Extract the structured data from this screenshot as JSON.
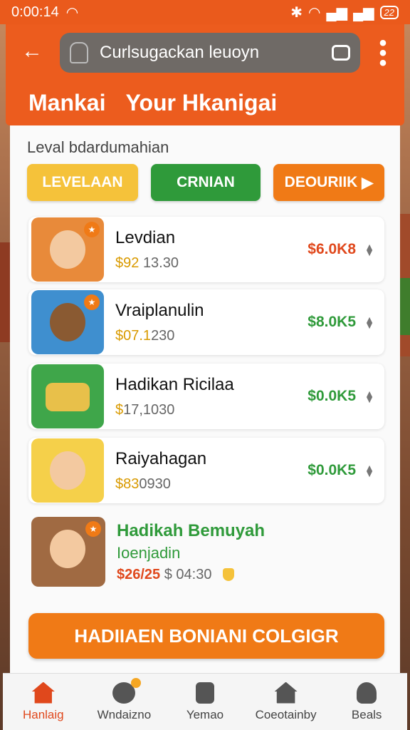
{
  "status_bar": {
    "time": "0:00:14",
    "battery": "22"
  },
  "header": {
    "search_text": "Curlsugackan leuoyn",
    "tab_left": "Mankai",
    "tab_right": "Your Hkanigai"
  },
  "main": {
    "subheading": "Leval bdardumahian",
    "filters": [
      "LEVELAAN",
      "CRNIAN",
      "DEOURIIK"
    ],
    "items": [
      {
        "name": "Levdian",
        "sub_prefix": "$92",
        "sub_value": "13.30",
        "price": "$6.0K8",
        "price_color": "#e0481c"
      },
      {
        "name": "Vraiplanulin",
        "sub_prefix": "$07.1",
        "sub_value": "230",
        "price": "$8.0K5",
        "price_color": "#2f9a3a"
      },
      {
        "name": "Hadikan Ricilaa",
        "sub_prefix": "$",
        "sub_value": "17,1030",
        "price": "$0.0K5",
        "price_color": "#2f9a3a"
      },
      {
        "name": "Raiyahagan",
        "sub_prefix": "$83",
        "sub_value": "0930",
        "price": "$0.0K5",
        "price_color": "#2f9a3a"
      }
    ],
    "featured": {
      "name": "Hadikah Bemuyah",
      "tag": "Ioenjadin",
      "price_main": "$26/25",
      "price_secondary": "$ 04:30"
    },
    "cta_label": "HADIIAEN BONIANI COLGIGR"
  },
  "nav": [
    {
      "label": "Hanlaig",
      "icon": "home-icon",
      "active": true
    },
    {
      "label": "Wndaizno",
      "icon": "gamepad-icon",
      "active": false
    },
    {
      "label": "Yemao",
      "icon": "clipboard-icon",
      "active": false
    },
    {
      "label": "Coeotainby",
      "icon": "house-badge-icon",
      "active": false
    },
    {
      "label": "Beals",
      "icon": "user-icon",
      "active": false
    }
  ],
  "colors": {
    "accent": "#ec5c1e",
    "green": "#2f9a3a",
    "yellow": "#f5c23a",
    "orange": "#f07a16"
  }
}
